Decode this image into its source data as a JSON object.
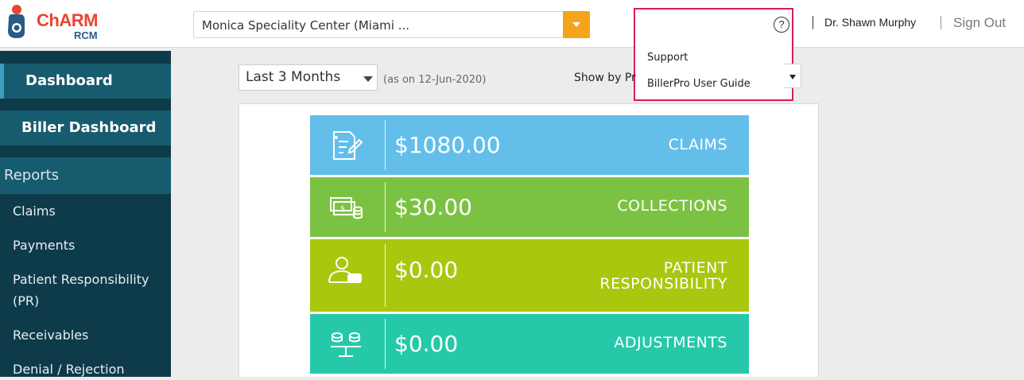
{
  "header": {
    "logo_text": "ChARM",
    "logo_sub": "RCM",
    "facility": "Monica Speciality Center (Miami ...",
    "user_name": "Dr. Shawn Murphy",
    "sign_out": "Sign Out",
    "help_icon": "?"
  },
  "help_menu": {
    "items": [
      "Support",
      "BillerPro User Guide"
    ]
  },
  "sidebar": {
    "dashboard": "Dashboard",
    "biller_dashboard": "Biller Dashboard",
    "reports": "Reports",
    "links": [
      "Claims",
      "Payments",
      "Patient Responsibility (PR)",
      "Receivables",
      "Denial / Rejection"
    ]
  },
  "filters": {
    "range": "Last 3 Months",
    "as_on": "(as on 12-Jun-2020)",
    "show_by": "Show by Pr"
  },
  "cards": [
    {
      "amount": "$1080.00",
      "label": "CLAIMS",
      "color": "#63bfea",
      "icon": "claims-doc-icon"
    },
    {
      "amount": "$30.00",
      "label": "COLLECTIONS",
      "color": "#7cc242",
      "icon": "cash-coins-icon"
    },
    {
      "amount": "$0.00",
      "label": "PATIENT RESPONSIBILITY",
      "color": "#a8c80f",
      "icon": "patient-wallet-icon"
    },
    {
      "amount": "$0.00",
      "label": "ADJUSTMENTS",
      "color": "#25c9a9",
      "icon": "balance-scale-icon"
    }
  ]
}
